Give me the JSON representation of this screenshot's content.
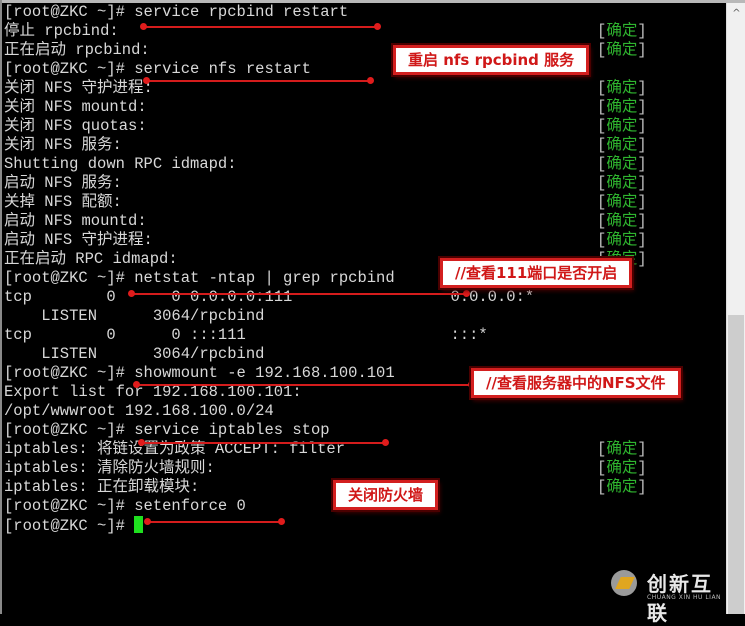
{
  "terminal": {
    "prompt": "[root@ZKC ~]# ",
    "lines": [
      {
        "text": "[root@ZKC ~]# service rpcbind restart",
        "status": null
      },
      {
        "text": "停止 rpcbind:",
        "status": "确定"
      },
      {
        "text": "正在启动 rpcbind:",
        "status": "确定"
      },
      {
        "text": "[root@ZKC ~]# service nfs restart",
        "status": null
      },
      {
        "text": "关闭 NFS 守护进程:",
        "status": "确定"
      },
      {
        "text": "关闭 NFS mountd:",
        "status": "确定"
      },
      {
        "text": "关闭 NFS quotas:",
        "status": "确定"
      },
      {
        "text": "关闭 NFS 服务:",
        "status": "确定"
      },
      {
        "text": "Shutting down RPC idmapd:",
        "status": "确定"
      },
      {
        "text": "启动 NFS 服务:",
        "status": "确定"
      },
      {
        "text": "关掉 NFS 配额:",
        "status": "确定"
      },
      {
        "text": "启动 NFS mountd:",
        "status": "确定"
      },
      {
        "text": "启动 NFS 守护进程:",
        "status": "确定"
      },
      {
        "text": "正在启动 RPC idmapd:",
        "status": "确定"
      },
      {
        "text": "[root@ZKC ~]# netstat -ntap | grep rpcbind",
        "status": null
      },
      {
        "text": "tcp        0      0 0.0.0.0:111                 0.0.0.0:*",
        "status": null
      },
      {
        "text": "    LISTEN      3064/rpcbind",
        "status": null
      },
      {
        "text": "tcp        0      0 :::111                      :::*",
        "status": null
      },
      {
        "text": "    LISTEN      3064/rpcbind",
        "status": null
      },
      {
        "text": "[root@ZKC ~]# showmount -e 192.168.100.101",
        "status": null
      },
      {
        "text": "Export list for 192.168.100.101:",
        "status": null
      },
      {
        "text": "/opt/wwwroot 192.168.100.0/24",
        "status": null
      },
      {
        "text": "[root@ZKC ~]# service iptables stop",
        "status": null
      },
      {
        "text": "iptables: 将链设置为政策 ACCEPT: filter",
        "status": "确定"
      },
      {
        "text": "iptables: 清除防火墙规则:",
        "status": "确定"
      },
      {
        "text": "iptables: 正在卸载模块:",
        "status": "确定"
      },
      {
        "text": "[root@ZKC ~]# setenforce 0",
        "status": null
      },
      {
        "text": "[root@ZKC ~]# ",
        "status": null
      }
    ],
    "status_open": "[",
    "status_close": "]"
  },
  "annotations": [
    {
      "id": "restart-services",
      "label": "重启 nfs rpcbind 服务"
    },
    {
      "id": "check-port",
      "label": "//查看111端口是否开启"
    },
    {
      "id": "check-exports",
      "label": "//查看服务器中的NFS文件"
    },
    {
      "id": "disable-firewall",
      "label": "关闭防火墙"
    }
  ],
  "scrollbar": {
    "up_arrow": "^"
  },
  "watermark": {
    "name": "创新互联",
    "subtitle": "CHUANG XIN HU LIAN"
  },
  "colors": {
    "background": "#000000",
    "text": "#d8d8d8",
    "status_ok": "#2fb52f",
    "cursor": "#1fe01f",
    "annotation": "#d31f1f"
  }
}
